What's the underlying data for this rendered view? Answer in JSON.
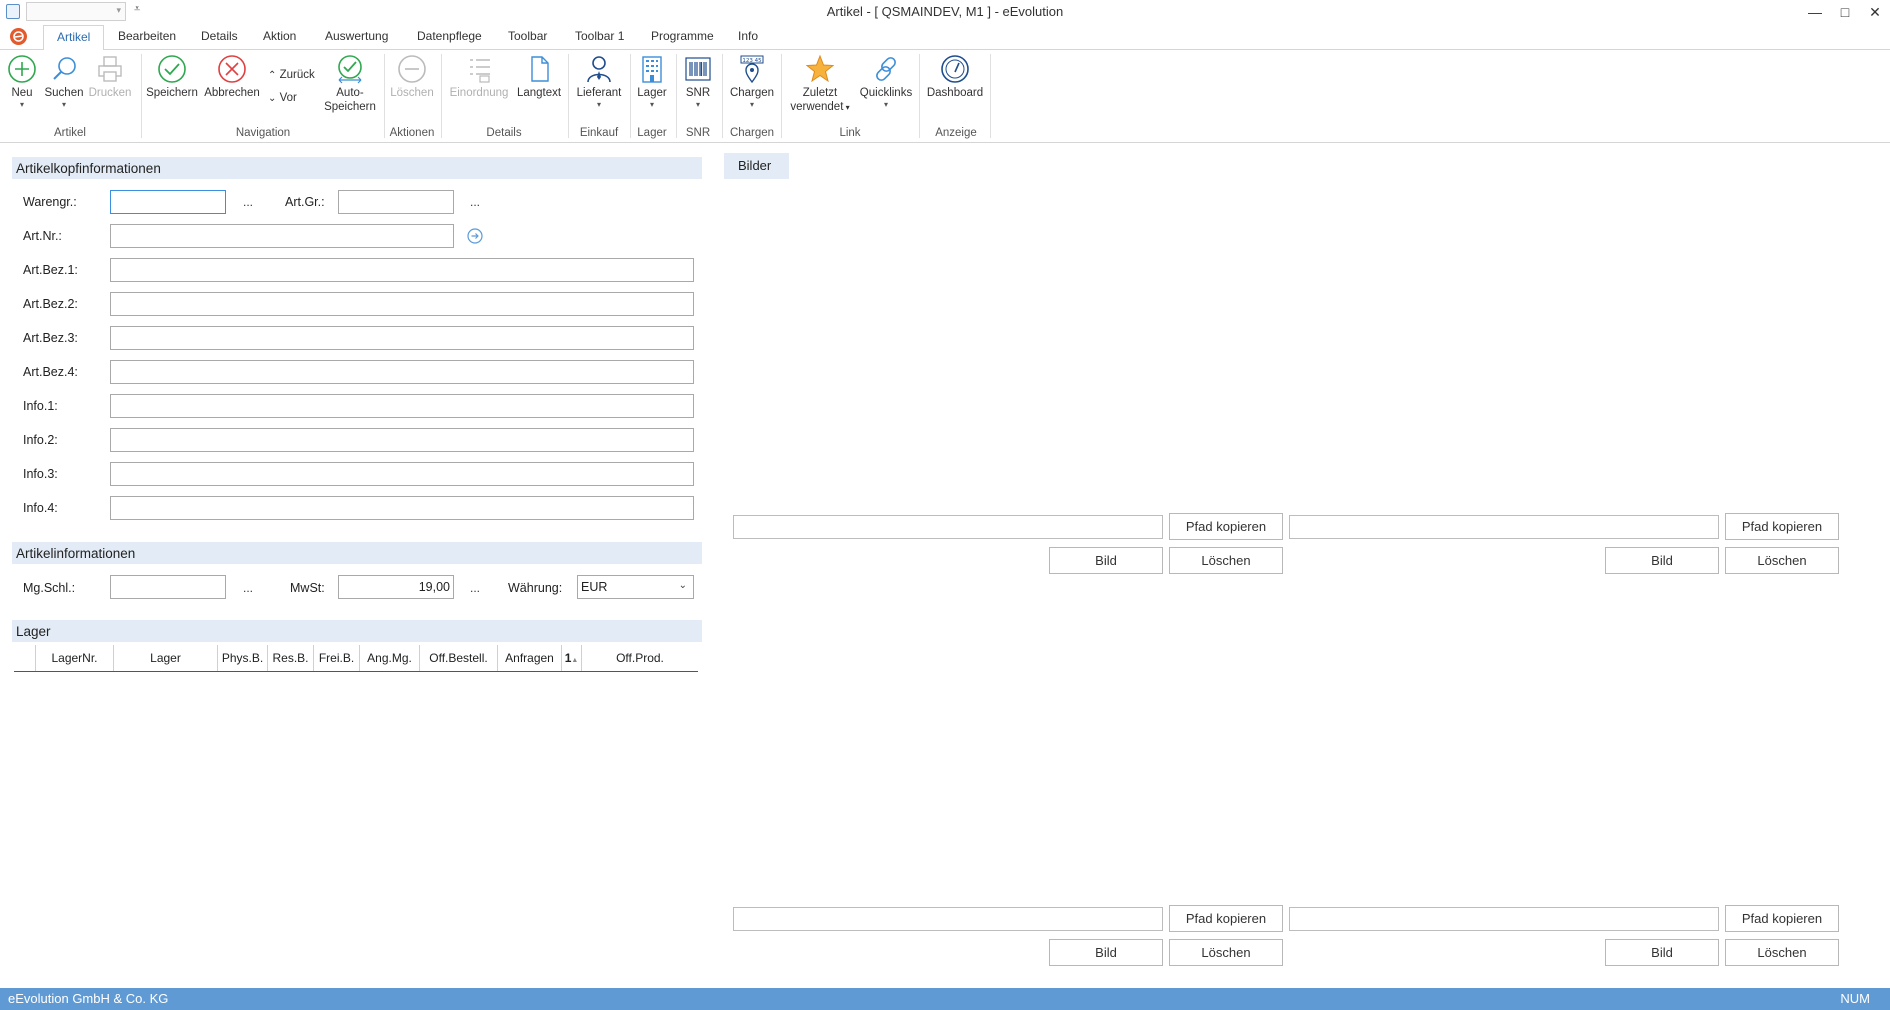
{
  "window": {
    "title": "Artikel - [ QSMAINDEV, M1 ]  -  eEvolution",
    "minimize_icon": "minimize-icon",
    "maximize_icon": "maximize-icon",
    "close_icon": "close-icon"
  },
  "tabs": [
    "Artikel",
    "Bearbeiten",
    "Details",
    "Aktion",
    "Auswertung",
    "Datenpflege",
    "Toolbar",
    "Toolbar 1",
    "Programme",
    "Info"
  ],
  "ribbon": {
    "neu": "Neu",
    "suchen": "Suchen",
    "drucken": "Drucken",
    "speichern": "Speichern",
    "abbrechen": "Abbrechen",
    "zurueck": "Zurück",
    "vor": "Vor",
    "auto_speichern_1": "Auto-",
    "auto_speichern_2": "Speichern",
    "loeschen": "Löschen",
    "einordnung": "Einordnung",
    "langtext": "Langtext",
    "lieferant": "Lieferant",
    "lager": "Lager",
    "snr": "SNR",
    "chargen": "Chargen",
    "zuletzt_1": "Zuletzt",
    "zuletzt_2": "verwendet",
    "quicklinks": "Quicklinks",
    "dashboard": "Dashboard",
    "groups": {
      "artikel": "Artikel",
      "navigation": "Navigation",
      "aktionen": "Aktionen",
      "details": "Details",
      "einkauf": "Einkauf",
      "lager": "Lager",
      "snr": "SNR",
      "chargen": "Chargen",
      "link": "Link",
      "anzeige": "Anzeige"
    }
  },
  "kopf": {
    "header": "Artikelkopfinformationen",
    "warengr": "Warengr.:",
    "artgr": "Art.Gr.:",
    "artnr": "Art.Nr.:",
    "bez1": "Art.Bez.1:",
    "bez2": "Art.Bez.2:",
    "bez3": "Art.Bez.3:",
    "bez4": "Art.Bez.4:",
    "info1": "Info.1:",
    "info2": "Info.2:",
    "info3": "Info.3:",
    "info4": "Info.4:",
    "ellipsis": "..."
  },
  "artikelinfo": {
    "header": "Artikelinformationen",
    "mgschl": "Mg.Schl.:",
    "mwst": "MwSt:",
    "mwst_value": "19,00",
    "waehrung": "Währung:",
    "waehrung_value": "EUR"
  },
  "lager": {
    "header": "Lager",
    "columns": [
      "LagerNr.",
      "Lager",
      "Phys.B.",
      "Res.B.",
      "Frei.B.",
      "Ang.Mg.",
      "Off.Bestell.",
      "Anfragen",
      "1",
      "Off.Prod."
    ]
  },
  "bilder": {
    "tab": "Bilder",
    "pfad_kopieren": "Pfad kopieren",
    "bild": "Bild",
    "loeschen": "Löschen"
  },
  "status": {
    "company": "eEvolution GmbH & Co. KG",
    "num": "NUM"
  }
}
